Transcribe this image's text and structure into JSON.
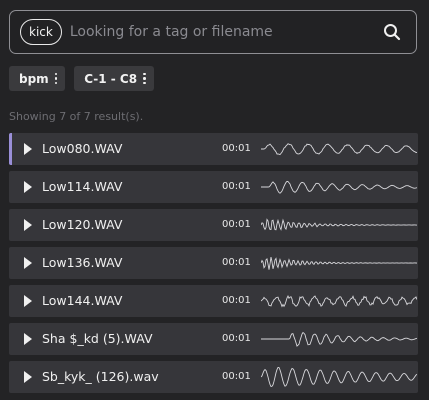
{
  "search": {
    "tag": "kick",
    "placeholder": "Looking for a tag or filename",
    "value": ""
  },
  "filters": [
    {
      "label": "bpm"
    },
    {
      "label": "C-1 - C8"
    }
  ],
  "results_text": "Showing 7 of 7 result(s).",
  "rows": [
    {
      "name": "Low080.WAV",
      "duration": "00:01",
      "active": true
    },
    {
      "name": "Low114.WAV",
      "duration": "00:01"
    },
    {
      "name": "Low120.WAV",
      "duration": "00:01"
    },
    {
      "name": "Low136.WAV",
      "duration": "00:01"
    },
    {
      "name": "Low144.WAV",
      "duration": "00:01"
    },
    {
      "name": "Sha $_kd (5).WAV",
      "duration": "00:01"
    },
    {
      "name": "Sb_kyk_ (126).wav",
      "duration": "00:01"
    }
  ],
  "colors": {
    "background": "#232325",
    "row": "#36363a",
    "active_accent": "#9a8fd8"
  }
}
